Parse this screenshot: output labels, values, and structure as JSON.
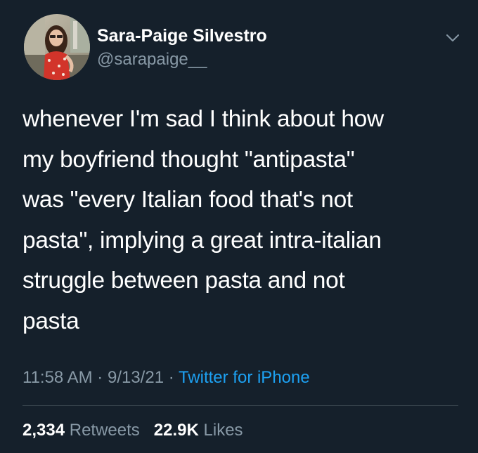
{
  "user": {
    "display_name": "Sara-Paige Silvestro",
    "handle": "@sarapaige__"
  },
  "tweet": {
    "text": "whenever I'm sad I think about how\nmy boyfriend thought \"antipasta\"\nwas \"every Italian food that's not\npasta\", implying a great intra-italian\nstruggle between pasta and not\npasta",
    "time": "11:58 AM",
    "date": "9/13/21",
    "separator": "·",
    "source": "Twitter for iPhone"
  },
  "stats": {
    "retweets_count": "2,334",
    "retweets_label": "Retweets",
    "likes_count": "22.9K",
    "likes_label": "Likes"
  },
  "icons": {
    "caret": "chevron-down-icon",
    "avatar": "avatar"
  },
  "colors": {
    "background": "#15202b",
    "primary_text": "#ffffff",
    "secondary_text": "#8899a6",
    "link": "#1da1f2",
    "divider": "#38444d"
  }
}
